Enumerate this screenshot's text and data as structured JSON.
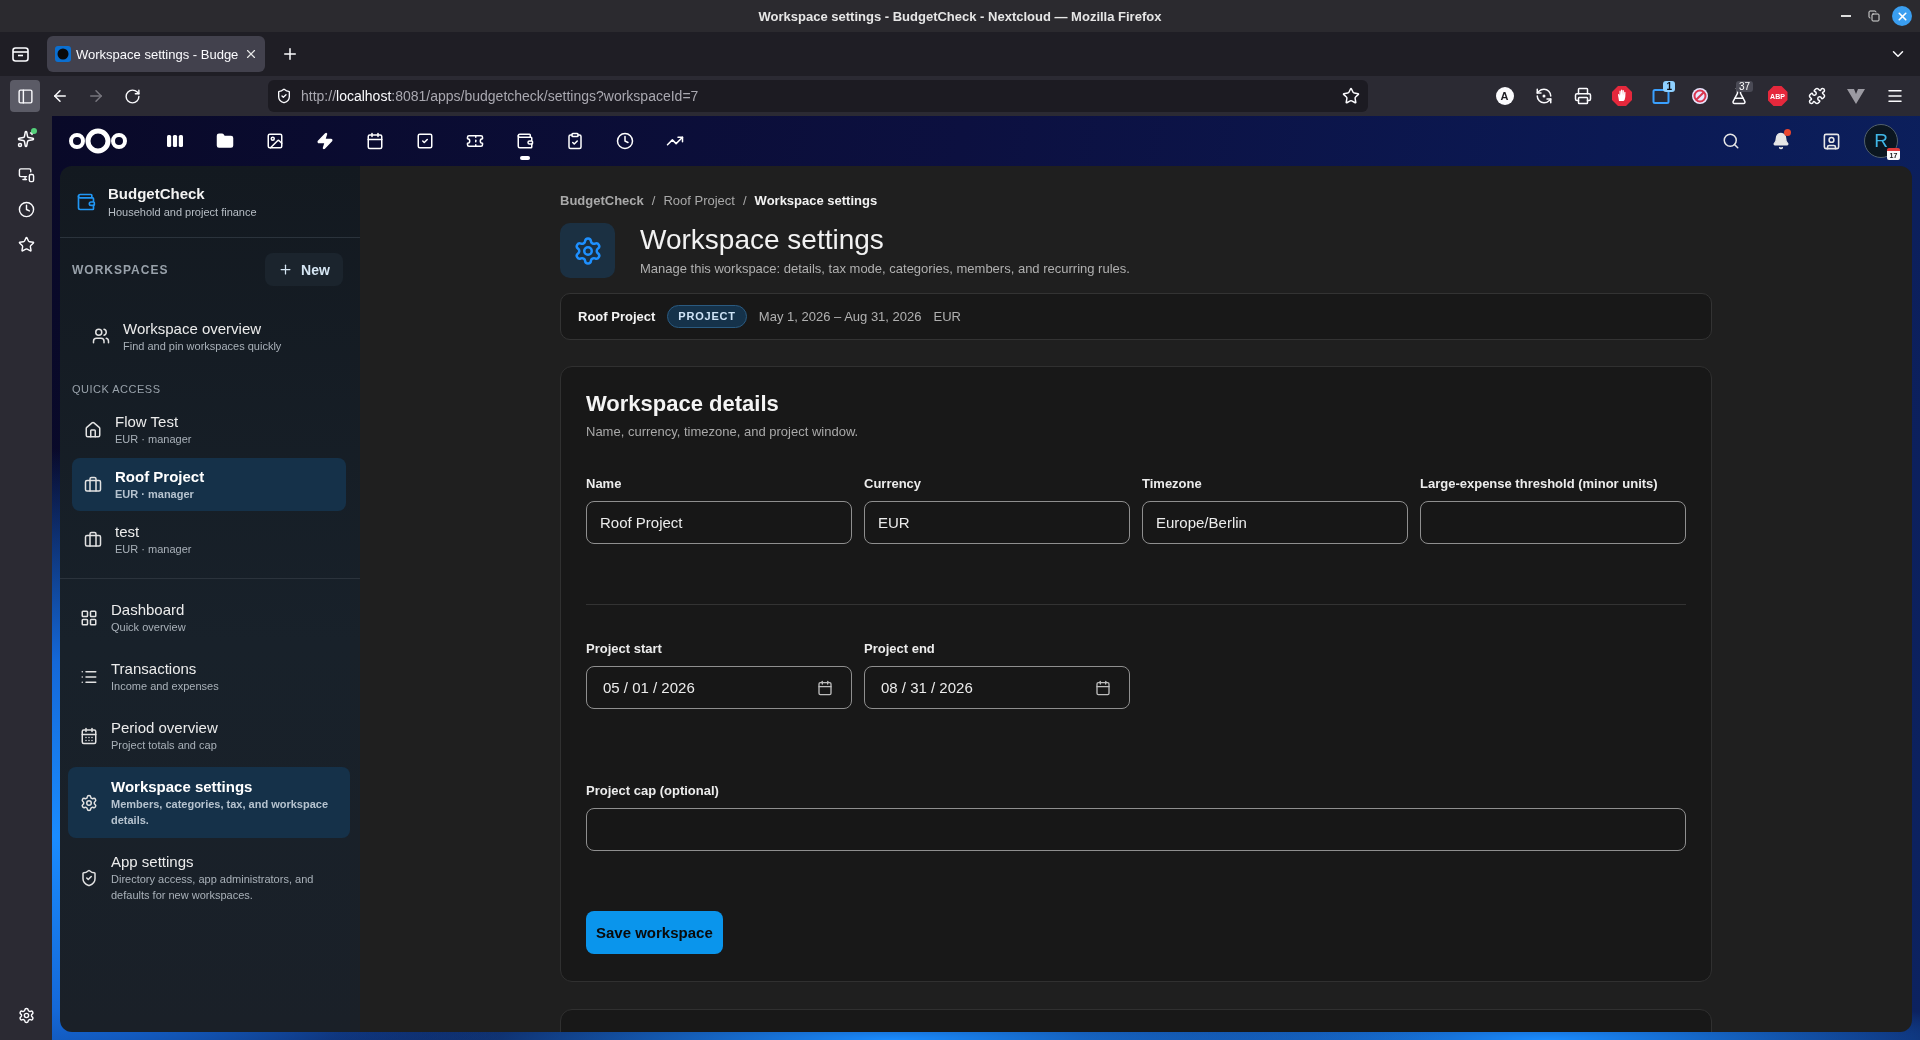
{
  "window": {
    "title": "Workspace settings - BudgetCheck - Nextcloud — Mozilla Firefox"
  },
  "browser": {
    "tabs": [
      {
        "title": "Workspace settings - Budge",
        "selected": true
      }
    ],
    "sidebar_open": true,
    "forward_disabled": true,
    "sidebar_notice": true,
    "url": {
      "scheme": "http://",
      "host": "localhost",
      "rest": ":8081/apps/budgetcheck/settings?workspaceId=7"
    },
    "extensions": [
      {
        "kind": "letter",
        "label": "A"
      },
      {
        "kind": "sync"
      },
      {
        "kind": "print"
      },
      {
        "kind": "hand"
      },
      {
        "kind": "counter",
        "badge": "1"
      },
      {
        "kind": "block"
      },
      {
        "kind": "flask",
        "badge": "37"
      },
      {
        "kind": "octagon",
        "label": "ABP"
      },
      {
        "kind": "puzzle"
      },
      {
        "kind": "v"
      },
      {
        "kind": "menu"
      }
    ]
  },
  "header": {
    "apps": [
      {
        "selected": false
      },
      {
        "selected": false
      },
      {
        "selected": false
      },
      {
        "selected": false
      },
      {
        "selected": false
      },
      {
        "selected": false
      },
      {
        "selected": false
      },
      {
        "selected": true
      },
      {
        "selected": false
      },
      {
        "selected": false
      },
      {
        "selected": false
      }
    ],
    "notifications_unread": true,
    "avatar": {
      "initial": "R",
      "calendar_day": "17"
    }
  },
  "navigation": {
    "app": {
      "name": "BudgetCheck",
      "tagline": "Household and project finance"
    },
    "workspaces_heading": "WORKSPACES",
    "new_button": "New",
    "overview": {
      "title": "Workspace overview",
      "subtitle": "Find and pin workspaces quickly"
    },
    "quick_access_heading": "QUICK ACCESS",
    "quick_access": [
      {
        "kind": "household",
        "name": "Flow Test",
        "meta": "EUR · manager",
        "selected": false
      },
      {
        "kind": "project",
        "name": "Roof Project",
        "meta": "EUR · manager",
        "selected": true
      },
      {
        "kind": "project",
        "name": "test",
        "meta": "EUR · manager",
        "selected": false
      }
    ],
    "items": [
      {
        "title": "Dashboard",
        "subtitle": "Quick overview",
        "selected": false
      },
      {
        "title": "Transactions",
        "subtitle": "Income and expenses",
        "selected": false
      },
      {
        "title": "Period overview",
        "subtitle": "Project totals and cap",
        "selected": false
      },
      {
        "title": "Workspace settings",
        "subtitle": "Members, categories, tax, and workspace details.",
        "selected": true
      },
      {
        "title": "App settings",
        "subtitle": "Directory access, app administrators, and defaults for new workspaces.",
        "selected": false
      }
    ]
  },
  "breadcrumb": [
    {
      "kind": "root",
      "label": "BudgetCheck"
    },
    {
      "kind": "separator",
      "label": "/"
    },
    {
      "kind": "link",
      "label": "Roof Project"
    },
    {
      "kind": "separator",
      "label": "/"
    },
    {
      "kind": "current",
      "label": "Workspace settings"
    }
  ],
  "page": {
    "title": "Workspace settings",
    "subtitle": "Manage this workspace: details, tax mode, categories, members, and recurring rules."
  },
  "summary": {
    "name": "Roof Project",
    "badge": "PROJECT",
    "dates": "May 1, 2026 – Aug 31, 2026",
    "currency": "EUR"
  },
  "details": {
    "title": "Workspace details",
    "subtitle": "Name, currency, timezone, and project window.",
    "groups": [
      {
        "rows": [
          [
            {
              "kind": "text",
              "label": "Name",
              "value": "Roof Project"
            },
            {
              "kind": "text",
              "label": "Currency",
              "value": "EUR"
            },
            {
              "kind": "text",
              "label": "Timezone",
              "value": "Europe/Berlin"
            },
            {
              "kind": "text",
              "label": "Large-expense threshold (minor units)"
            }
          ]
        ]
      },
      {
        "rows": [
          [
            {
              "kind": "date",
              "label": "Project start",
              "value": "05 / 01 / 2026"
            },
            {
              "kind": "date",
              "label": "Project end",
              "value": "08 / 31 / 2026"
            }
          ],
          [
            {
              "kind": "text",
              "label": "Project cap (optional)"
            }
          ]
        ]
      }
    ],
    "save_button": "Save workspace"
  }
}
